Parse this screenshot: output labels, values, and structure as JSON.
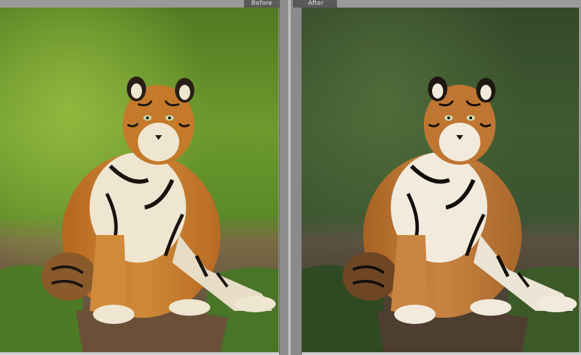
{
  "compare_view": {
    "before_label": "Before",
    "after_label": "After"
  },
  "colors": {
    "before_background_green": "#5a8a2a",
    "after_background_green": "#3e5a30",
    "tiger_orange": "#c47a2a",
    "chrome_gray": "#9a9a9a"
  }
}
